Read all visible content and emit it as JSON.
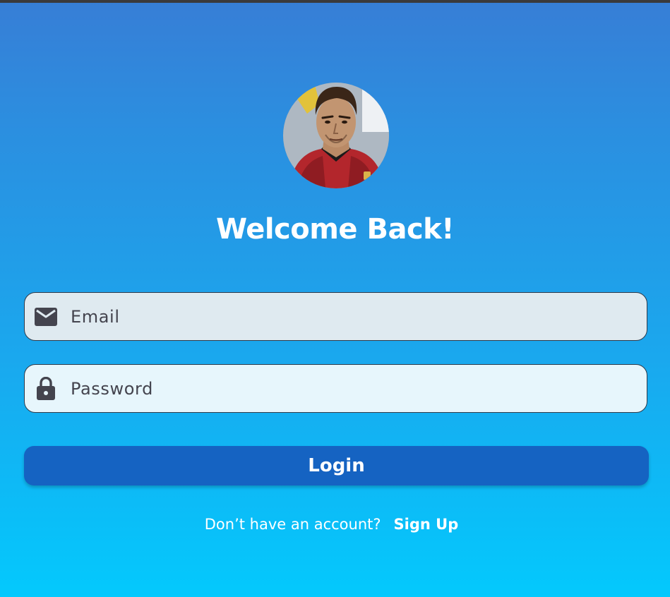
{
  "header": {
    "title": "Welcome Back!"
  },
  "avatar": {
    "icon": "profile-photo"
  },
  "form": {
    "email": {
      "icon": "mail-icon",
      "value": "",
      "placeholder": "Email"
    },
    "password": {
      "icon": "lock-icon",
      "value": "",
      "placeholder": "Password"
    },
    "login_label": "Login"
  },
  "footer": {
    "prompt": "Don’t have an account?",
    "signup_label": "Sign Up"
  },
  "colors": {
    "gradient_top": "#377ed6",
    "gradient_bottom": "#03c9fd",
    "button": "#1563c2",
    "email_field_bg": "#dfeaf0",
    "password_field_bg": "#e7f6fc",
    "icon": "#44444e"
  }
}
